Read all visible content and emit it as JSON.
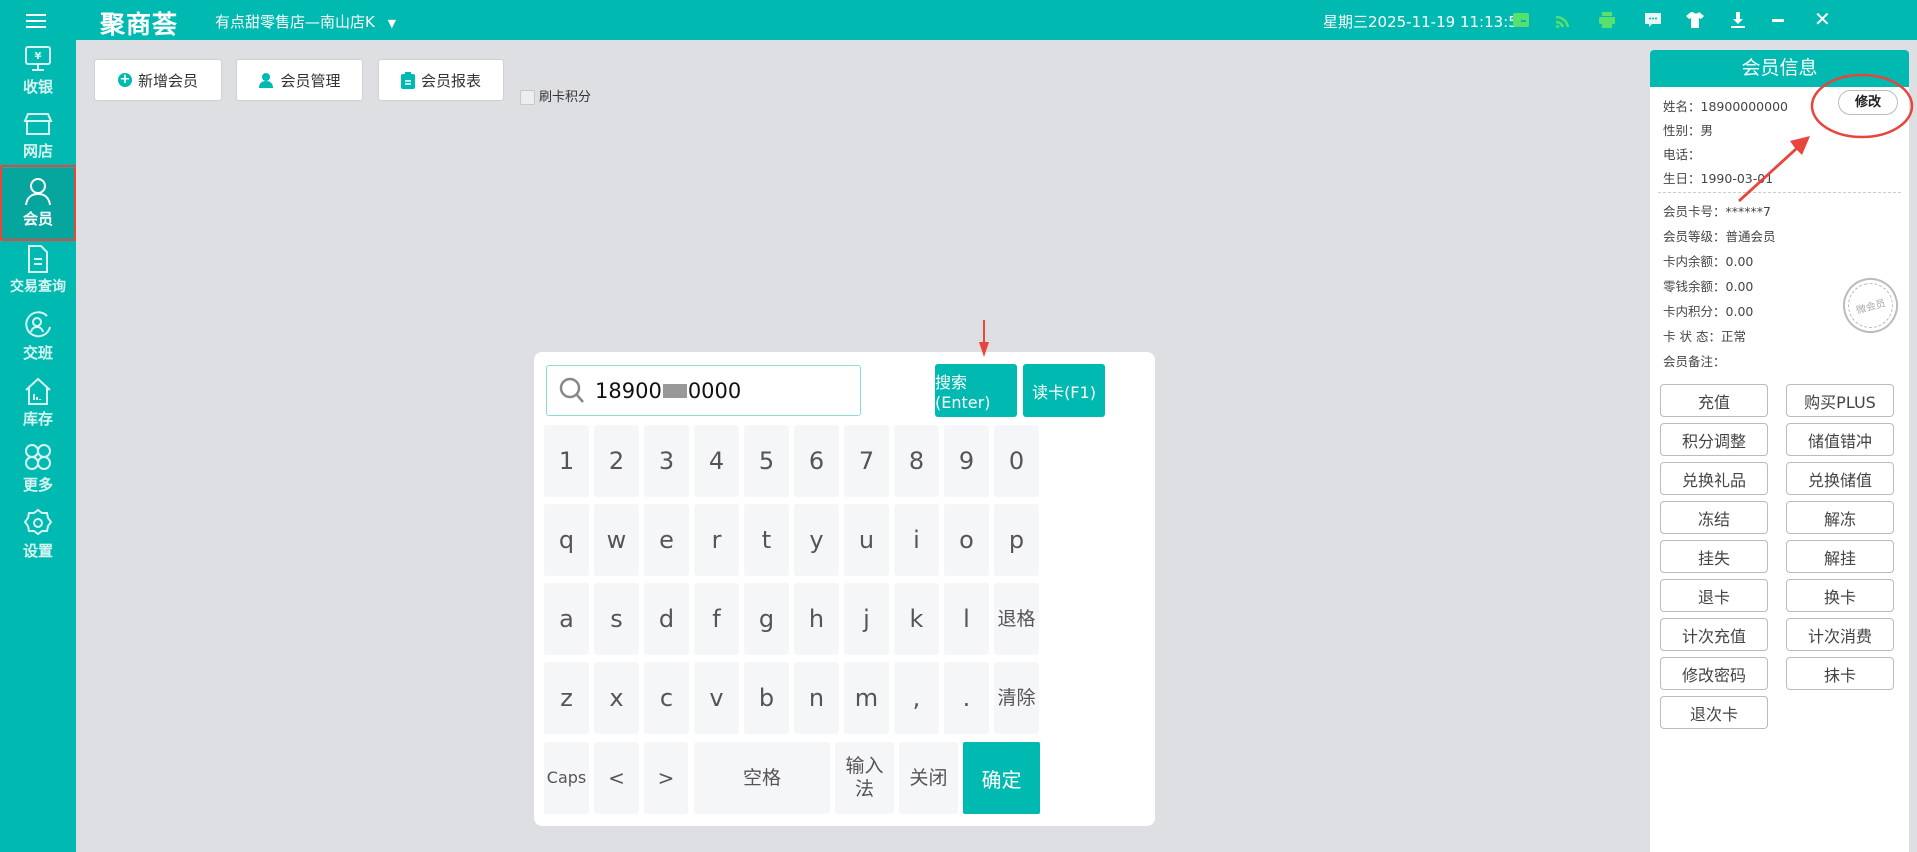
{
  "topbar": {
    "logo": "聚商荟",
    "store": "有点甜零售店—南山店K",
    "datetime": "星期三2025-11-19 11:13:58",
    "icons": [
      "menu-icon",
      "cash-box-icon",
      "wifi-icon",
      "printer-icon",
      "message-icon",
      "shirt-icon",
      "download-icon",
      "minimize-icon",
      "close-icon"
    ]
  },
  "sidebar": {
    "items": [
      {
        "label": "收银",
        "icon": "cash-register-icon"
      },
      {
        "label": "网店",
        "icon": "shop-icon"
      },
      {
        "label": "会员",
        "icon": "user-icon"
      },
      {
        "label": "交易查询",
        "icon": "document-icon"
      },
      {
        "label": "交班",
        "icon": "shift-icon"
      },
      {
        "label": "库存",
        "icon": "inventory-icon"
      },
      {
        "label": "更多",
        "icon": "more-icon"
      },
      {
        "label": "设置",
        "icon": "gear-icon"
      }
    ],
    "active": "会员"
  },
  "toolbar": {
    "add_member": "新增会员",
    "manage_member": "会员管理",
    "member_report": "会员报表",
    "swipe_points": "刷卡积分"
  },
  "keyboard": {
    "search_value_prefix": "18900",
    "search_value_suffix": "0000",
    "search_btn": "搜索(Enter)",
    "read_card_btn": "读卡(F1)",
    "rows": [
      [
        "1",
        "2",
        "3",
        "4",
        "5",
        "6",
        "7",
        "8",
        "9",
        "0"
      ],
      [
        "q",
        "w",
        "e",
        "r",
        "t",
        "y",
        "u",
        "i",
        "o",
        "p"
      ],
      [
        "a",
        "s",
        "d",
        "f",
        "g",
        "h",
        "j",
        "k",
        "l",
        "退格"
      ],
      [
        "z",
        "x",
        "c",
        "v",
        "b",
        "n",
        "m",
        ",",
        ".",
        "清除"
      ]
    ],
    "caps": "Caps",
    "left": "<",
    "right": ">",
    "space": "空格",
    "ime": "输入法",
    "close": "关闭",
    "confirm": "确定"
  },
  "member": {
    "title": "会员信息",
    "edit": "修改",
    "basic": [
      [
        "姓名：",
        "18900000000"
      ],
      [
        "性别：",
        "男"
      ],
      [
        "电话：",
        ""
      ],
      [
        "生日：",
        "1990-03-01"
      ]
    ],
    "card": [
      [
        "会员卡号：",
        "******7"
      ],
      [
        "会员等级：",
        "普通会员"
      ],
      [
        "卡内余额：",
        "0.00"
      ],
      [
        "零钱余额：",
        "0.00"
      ],
      [
        "卡内积分：",
        "0.00"
      ],
      [
        "卡 状 态：",
        "正常"
      ],
      [
        "会员备注：",
        ""
      ]
    ],
    "stamp": "微会员",
    "actions": [
      "充值",
      "购买PLUS",
      "积分调整",
      "储值错冲",
      "兑换礼品",
      "兑换储值",
      "冻结",
      "解冻",
      "挂失",
      "解挂",
      "退卡",
      "换卡",
      "计次充值",
      "计次消费",
      "修改密码",
      "抹卡",
      "退次卡"
    ]
  },
  "colors": {
    "accent": "#00bab2",
    "annotation": "#e8453c"
  }
}
